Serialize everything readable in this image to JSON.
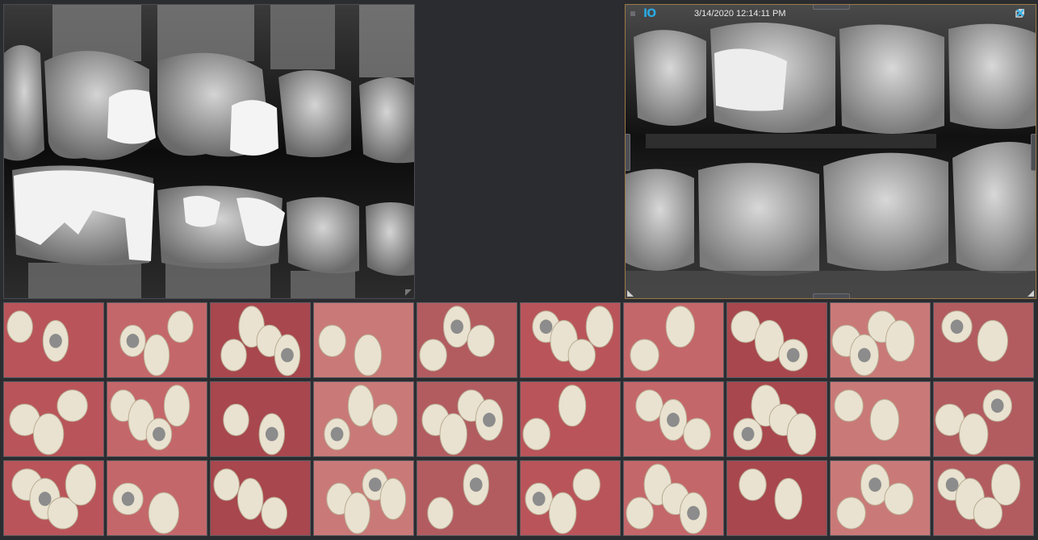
{
  "viewer_left": {
    "name": "bitewing-xray-left"
  },
  "viewer_right": {
    "name": "bitewing-xray-right",
    "logo": "IO",
    "timestamp": "3/14/2020 12:14:11 PM",
    "icons": [
      "restore-icon",
      "close-icon"
    ]
  },
  "colors": {
    "background": "#2b2c30",
    "selected_border": "#9a7a45",
    "logo": "#2aa8e0",
    "close": "#3cb4e6"
  },
  "thumbnails": {
    "rows": 3,
    "columns": 10,
    "count": 30
  }
}
